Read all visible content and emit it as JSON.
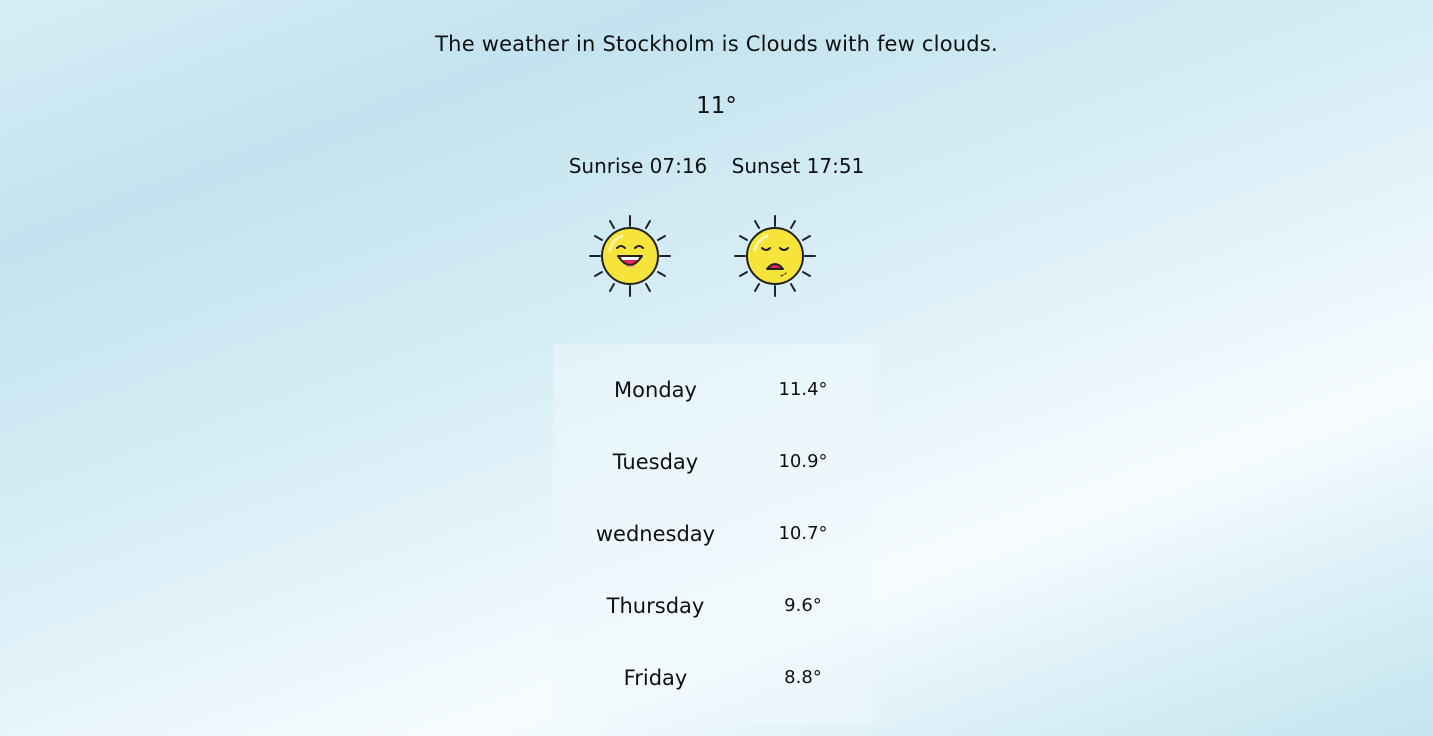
{
  "headline": "The weather in Stockholm is Clouds with few clouds.",
  "current_temp": "11°",
  "sunrise": {
    "label": "Sunrise",
    "time": "07:16"
  },
  "sunset": {
    "label": "Sunset",
    "time": "17:51"
  },
  "icons": {
    "sunrise": "happy-sun-icon",
    "sunset": "sad-sun-icon"
  },
  "colors": {
    "sun_fill": "#f6e43a",
    "sun_stroke": "#222222",
    "mouth": "#e0245e"
  },
  "forecast": [
    {
      "day": "Monday",
      "temp": "11.4°"
    },
    {
      "day": "Tuesday",
      "temp": "10.9°"
    },
    {
      "day": "wednesday",
      "temp": "10.7°"
    },
    {
      "day": "Thursday",
      "temp": "9.6°"
    },
    {
      "day": "Friday",
      "temp": "8.8°"
    }
  ]
}
